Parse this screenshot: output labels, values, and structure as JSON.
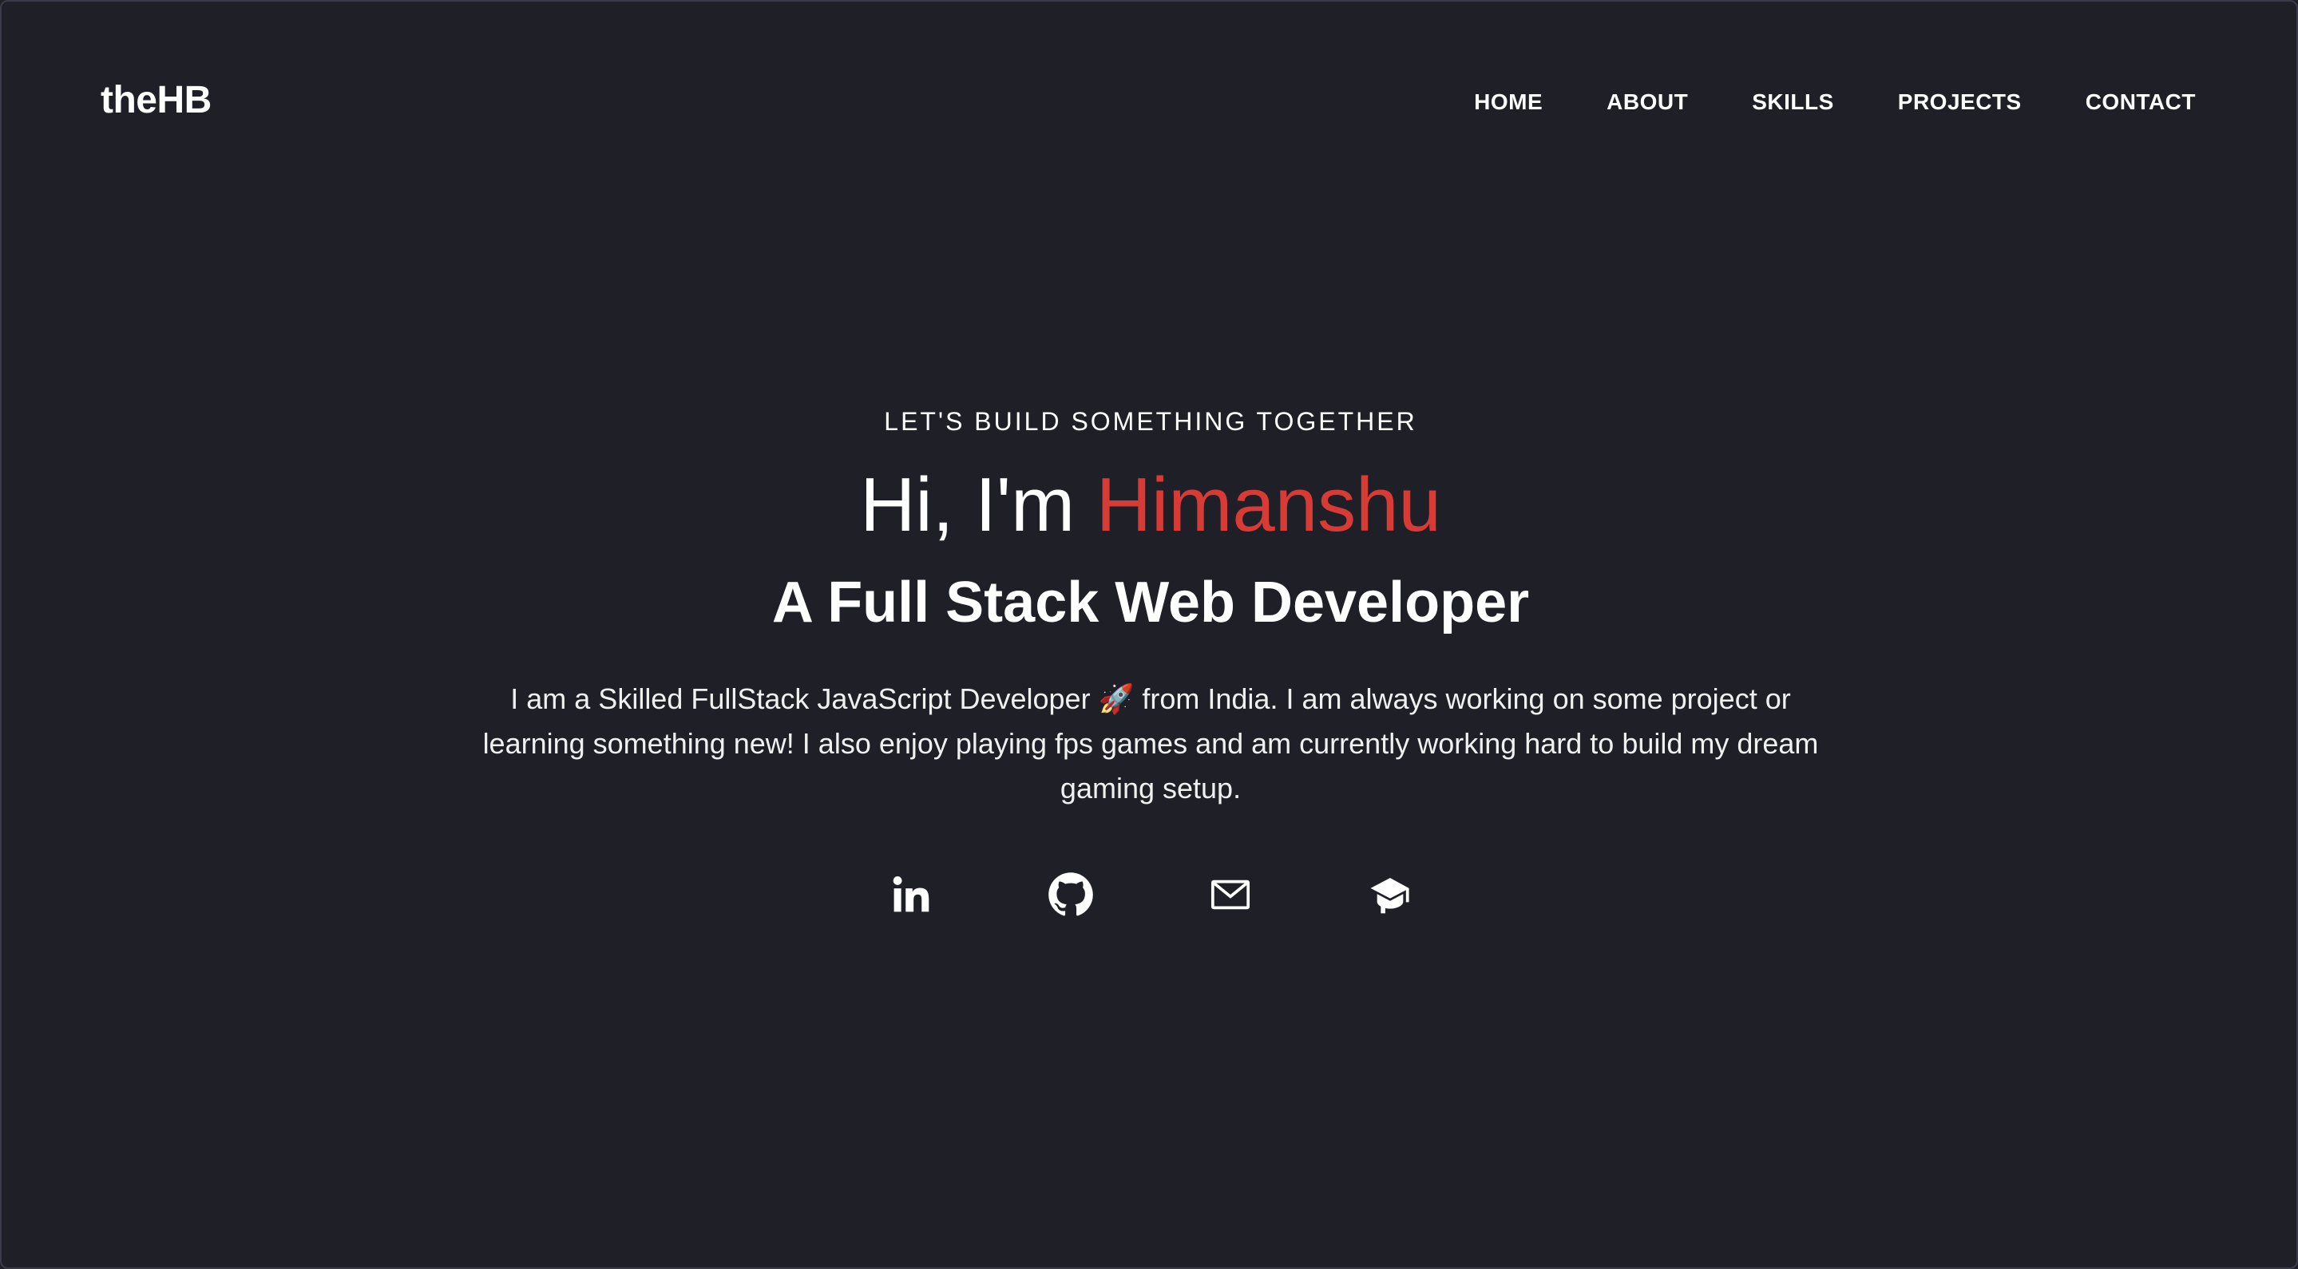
{
  "brand": {
    "logo": "theHB"
  },
  "nav": {
    "items": [
      {
        "label": "HOME"
      },
      {
        "label": "ABOUT"
      },
      {
        "label": "SKILLS"
      },
      {
        "label": "PROJECTS"
      },
      {
        "label": "CONTACT"
      }
    ]
  },
  "hero": {
    "eyebrow": "LET'S BUILD SOMETHING TOGETHER",
    "greeting_prefix": "Hi, I'm ",
    "name": "Himanshu",
    "role": "A Full Stack Web Developer",
    "bio": "I am a Skilled FullStack JavaScript Developer 🚀 from India. I am always working on some project or learning something new! I also enjoy playing fps games and am currently working hard to build my dream gaming setup."
  },
  "socials": [
    {
      "icon": "linkedin-icon"
    },
    {
      "icon": "github-icon"
    },
    {
      "icon": "mail-icon"
    },
    {
      "icon": "graduation-cap-icon"
    }
  ],
  "colors": {
    "background": "#1f2027",
    "accent": "#d83b35",
    "text": "#ffffff"
  }
}
